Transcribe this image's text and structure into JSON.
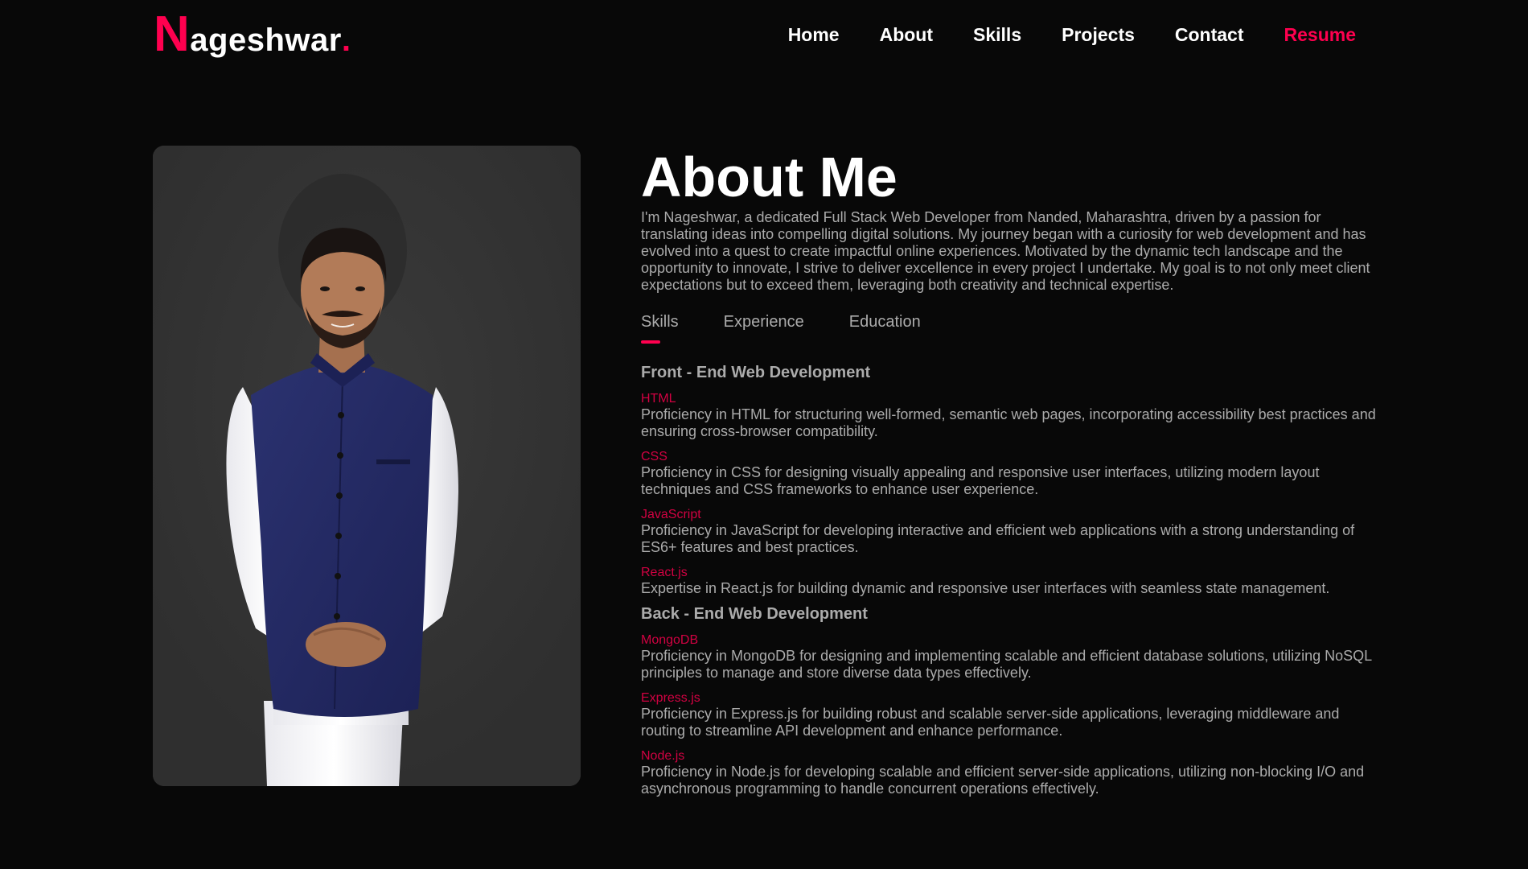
{
  "brand": {
    "first_letter": "N",
    "rest": "ageshwar",
    "dot": ".",
    "accent_color": "#ff004f"
  },
  "nav": {
    "items": [
      {
        "label": "Home"
      },
      {
        "label": "About"
      },
      {
        "label": "Skills"
      },
      {
        "label": "Projects"
      },
      {
        "label": "Contact"
      },
      {
        "label": "Resume"
      }
    ]
  },
  "about": {
    "title": "About Me",
    "intro": "I'm Nageshwar, a dedicated Full Stack Web Developer from Nanded, Maharashtra, driven by a passion for translating ideas into compelling digital solutions. My journey began with a curiosity for web development and has evolved into a quest to create impactful online experiences. Motivated by the dynamic tech landscape and the opportunity to innovate, I strive to deliver excellence in every project I undertake. My goal is to not only meet client expectations but to exceed them, leveraging both creativity and technical expertise."
  },
  "tabs": [
    {
      "label": "Skills",
      "active": true
    },
    {
      "label": "Experience",
      "active": false
    },
    {
      "label": "Education",
      "active": false
    }
  ],
  "skills": {
    "frontend": {
      "title": "Front - End Web Development",
      "items": [
        {
          "name": "HTML",
          "desc": "Proficiency in HTML for structuring well-formed, semantic web pages, incorporating accessibility best practices and ensuring cross-browser compatibility."
        },
        {
          "name": "CSS",
          "desc": "Proficiency in CSS for designing visually appealing and responsive user interfaces, utilizing modern layout techniques and CSS frameworks to enhance user experience."
        },
        {
          "name": "JavaScript",
          "desc": "Proficiency in JavaScript for developing interactive and efficient web applications with a strong understanding of ES6+ features and best practices."
        },
        {
          "name": "React.js",
          "desc": "Expertise in React.js for building dynamic and responsive user interfaces with seamless state management."
        }
      ]
    },
    "backend": {
      "title": "Back - End Web Development",
      "items": [
        {
          "name": "MongoDB",
          "desc": "Proficiency in MongoDB for designing and implementing scalable and efficient database solutions, utilizing NoSQL principles to manage and store diverse data types effectively."
        },
        {
          "name": "Express.js",
          "desc": "Proficiency in Express.js for building robust and scalable server-side applications, leveraging middleware and routing to streamline API development and enhance performance."
        },
        {
          "name": "Node.js",
          "desc": "Proficiency in Node.js for developing scalable and efficient server-side applications, utilizing non-blocking I/O and asynchronous programming to handle concurrent operations effectively."
        }
      ]
    }
  }
}
